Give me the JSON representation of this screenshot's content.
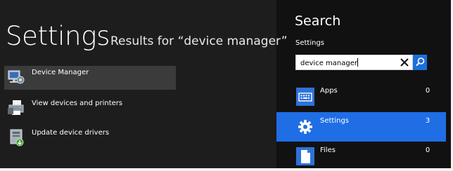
{
  "page": {
    "title": "Settings",
    "results_heading": "Results for “device manager”"
  },
  "results": [
    {
      "label": "Device Manager",
      "icon": "device-manager-icon",
      "selected": true
    },
    {
      "label": "View devices and printers",
      "icon": "printer-icon",
      "selected": false
    },
    {
      "label": "Update device drivers",
      "icon": "driver-update-icon",
      "selected": false
    }
  ],
  "search_pane": {
    "title": "Search",
    "scope": "Settings",
    "query": "device manager",
    "clear_icon": "close-icon",
    "go_icon": "search-icon",
    "apps": [
      {
        "name": "Apps",
        "count": "0",
        "icon": "keyboard-icon",
        "selected": false
      },
      {
        "name": "Settings",
        "count": "3",
        "icon": "gear-icon",
        "selected": true
      },
      {
        "name": "Files",
        "count": "0",
        "icon": "document-icon",
        "selected": false
      }
    ]
  },
  "colors": {
    "main_background": "#1d1d1d",
    "pane_background": "#111111",
    "accent": "#1f6ee6",
    "selected_result": "#3b3b3b"
  }
}
